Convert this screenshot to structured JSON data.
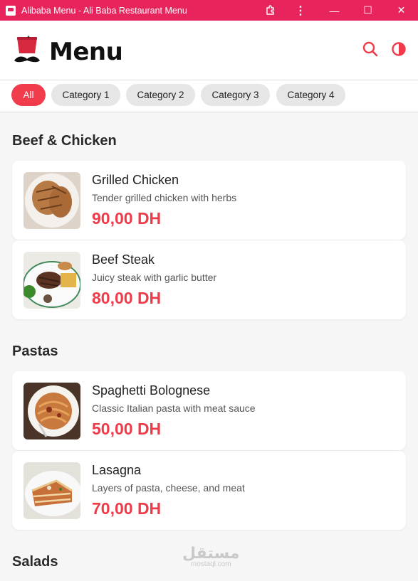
{
  "window": {
    "title": "Alibaba Menu - Ali Baba Restaurant Menu",
    "controls": {
      "minimize": "—",
      "maximize": "☐",
      "close": "✕"
    }
  },
  "header": {
    "title": "Menu",
    "icons": [
      "search-icon",
      "contrast-icon"
    ]
  },
  "categories": [
    "All",
    "Category 1",
    "Category 2",
    "Category 3",
    "Category 4"
  ],
  "active_category": "All",
  "sections": [
    {
      "title": "Beef & Chicken",
      "items": [
        {
          "name": "Grilled Chicken",
          "description": "Tender grilled chicken with herbs",
          "price": "90,00 DH"
        },
        {
          "name": "Beef Steak",
          "description": "Juicy steak with garlic butter",
          "price": "80,00 DH"
        }
      ]
    },
    {
      "title": "Pastas",
      "items": [
        {
          "name": "Spaghetti Bolognese",
          "description": "Classic Italian pasta with meat sauce",
          "price": "50,00 DH"
        },
        {
          "name": "Lasagna",
          "description": "Layers of pasta, cheese, and meat",
          "price": "70,00 DH"
        }
      ]
    },
    {
      "title": "Salads",
      "items": []
    }
  ],
  "watermark": {
    "arabic": "مستقل",
    "latin": "mostaql.com"
  },
  "colors": {
    "titlebar": "#e8245c",
    "accent": "#ef3b49",
    "chip": "#e6e6e6"
  }
}
